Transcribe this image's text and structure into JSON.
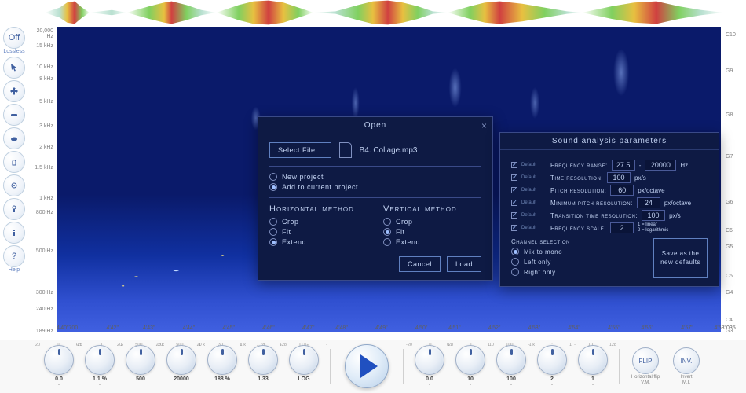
{
  "left_toolbar": {
    "items": [
      {
        "label": "Off",
        "sublabel": "Lossless",
        "icon": "off"
      },
      {
        "label": "",
        "sublabel": "",
        "icon": "pointer"
      },
      {
        "label": "",
        "sublabel": "",
        "icon": "move"
      },
      {
        "label": "",
        "sublabel": "",
        "icon": "select"
      },
      {
        "label": "",
        "sublabel": "",
        "icon": "erase"
      },
      {
        "label": "",
        "sublabel": "",
        "icon": "spray"
      },
      {
        "label": "",
        "sublabel": "",
        "icon": "circle"
      },
      {
        "label": "",
        "sublabel": "",
        "icon": "ellipse"
      },
      {
        "label": "",
        "sublabel": "",
        "icon": "vertical"
      },
      {
        "label": "",
        "sublabel": "",
        "icon": "info"
      },
      {
        "label": "?",
        "sublabel": "Help",
        "icon": "help"
      }
    ]
  },
  "y_axis_left": {
    "ticks": [
      {
        "pos": 1,
        "label": "20,000 Hz"
      },
      {
        "pos": 12,
        "label": "15 kHz"
      },
      {
        "pos": 27,
        "label": "10 kHz"
      },
      {
        "pos": 36,
        "label": "8 kHz"
      },
      {
        "pos": 52,
        "label": "5 kHz"
      },
      {
        "pos": 70,
        "label": "3 kHz"
      },
      {
        "pos": 85,
        "label": "2 kHz"
      },
      {
        "pos": 100,
        "label": "1.5 kHz"
      },
      {
        "pos": 122,
        "label": "1 kHz"
      },
      {
        "pos": 132,
        "label": "800 Hz"
      },
      {
        "pos": 160,
        "label": "500 Hz"
      },
      {
        "pos": 190,
        "label": "300 Hz"
      },
      {
        "pos": 202,
        "label": "240 Hz"
      },
      {
        "pos": 218,
        "label": "189 Hz"
      }
    ]
  },
  "y_axis_right": {
    "ticks": [
      {
        "pos": 4,
        "label": "C10"
      },
      {
        "pos": 30,
        "label": "G9"
      },
      {
        "pos": 62,
        "label": "G8"
      },
      {
        "pos": 92,
        "label": "G7"
      },
      {
        "pos": 125,
        "label": "G6"
      },
      {
        "pos": 145,
        "label": "C6"
      },
      {
        "pos": 157,
        "label": "G5"
      },
      {
        "pos": 178,
        "label": "C5"
      },
      {
        "pos": 190,
        "label": "G4"
      },
      {
        "pos": 210,
        "label": "C4"
      },
      {
        "pos": 218,
        "label": "G3"
      }
    ]
  },
  "x_axis": {
    "ticks": [
      {
        "pct": 0,
        "label": "4'40\"700"
      },
      {
        "pct": 7.5,
        "label": "4'42\""
      },
      {
        "pct": 13,
        "label": "4'43\""
      },
      {
        "pct": 19,
        "label": "4'44\""
      },
      {
        "pct": 25,
        "label": "4'45\""
      },
      {
        "pct": 31,
        "label": "4'46\""
      },
      {
        "pct": 37,
        "label": "4'47\""
      },
      {
        "pct": 42,
        "label": "4'48\""
      },
      {
        "pct": 48,
        "label": "4'49\""
      },
      {
        "pct": 54,
        "label": "4'50\""
      },
      {
        "pct": 59,
        "label": "4'51\""
      },
      {
        "pct": 65,
        "label": "4'52\""
      },
      {
        "pct": 71,
        "label": "4'53\""
      },
      {
        "pct": 77,
        "label": "4'54\""
      },
      {
        "pct": 83,
        "label": "4'55\""
      },
      {
        "pct": 88,
        "label": "4'56\""
      },
      {
        "pct": 94,
        "label": "4'57\""
      },
      {
        "pct": 99,
        "label": "4'58\"035"
      }
    ]
  },
  "bottom_panel": {
    "knobs_left": [
      {
        "scale": [
          "20",
          "0",
          "-20"
        ],
        "value": "0.0",
        "label": "-"
      },
      {
        "scale": [
          "0.5",
          "1",
          "2"
        ],
        "value": "1.1 %",
        "label": "-"
      },
      {
        "scale": [
          "20",
          "500",
          "20 k"
        ],
        "value": "500",
        "label": ""
      },
      {
        "scale": [
          "20",
          "500",
          "20 k"
        ],
        "value": "20000",
        "label": ""
      },
      {
        "scale": [
          "1",
          "30",
          "1 k"
        ],
        "value": "188 %",
        "label": ""
      },
      {
        "scale": [
          "1",
          "1.78",
          "128"
        ],
        "value": "1.33",
        "label": ""
      },
      {
        "scale": [
          "-",
          "LOG",
          "-"
        ],
        "value": "LOG",
        "label": ""
      }
    ],
    "knobs_right": [
      {
        "scale": [
          "-20",
          "0",
          "20"
        ],
        "value": "0.0",
        "label": "-"
      },
      {
        "scale": [
          "0.1",
          "1",
          "10"
        ],
        "value": "10",
        "label": "-"
      },
      {
        "scale": [
          "1",
          "100",
          "1 k"
        ],
        "value": "100",
        "label": "-"
      },
      {
        "scale": [
          "-",
          "1:1",
          "-"
        ],
        "value": "2",
        "label": "-"
      },
      {
        "scale": [
          "1",
          "10",
          "128"
        ],
        "value": "1",
        "label": "-"
      }
    ],
    "flip_label": "FLIP",
    "flip_sublabel": "Horizontal flip",
    "inv_label": "INV.",
    "inv_sublabel1": "Invert",
    "inv_sublabel2": "M.I.",
    "vm_label": "V.M."
  },
  "open_dialog": {
    "title": "Open",
    "select_file_btn": "Select File...",
    "filename": "B4. Collage.mp3",
    "new_project": "New project",
    "add_to_current": "Add to current project",
    "horizontal_title": "Horizontal method",
    "vertical_title": "Vertical method",
    "crop": "Crop",
    "fit": "Fit",
    "extend": "Extend",
    "cancel": "Cancel",
    "load": "Load"
  },
  "params_dialog": {
    "title": "Sound analysis parameters",
    "default_label": "Default",
    "freq_range_label": "Frequency range:",
    "freq_range_lo": "27.5",
    "freq_range_hi": "20000",
    "freq_range_unit": "Hz",
    "time_res_label": "Time resolution:",
    "time_res_val": "100",
    "time_res_unit": "px/s",
    "pitch_res_label": "Pitch resolution:",
    "pitch_res_val": "60",
    "pitch_res_unit": "px/octave",
    "min_pitch_label": "Minimum pitch resolution:",
    "min_pitch_val": "24",
    "min_pitch_unit": "px/octave",
    "trans_time_label": "Transition time resolution:",
    "trans_time_val": "100",
    "trans_time_unit": "px/s",
    "freq_scale_label": "Frequency scale:",
    "freq_scale_val": "2",
    "freq_scale_note1": "1 = linear",
    "freq_scale_note2": "2 = logarithmic",
    "channel_title": "Channel selection",
    "mix_mono": "Mix to mono",
    "left_only": "Left only",
    "right_only": "Right only",
    "save_defaults_l1": "Save as the",
    "save_defaults_l2": "new defaults"
  }
}
